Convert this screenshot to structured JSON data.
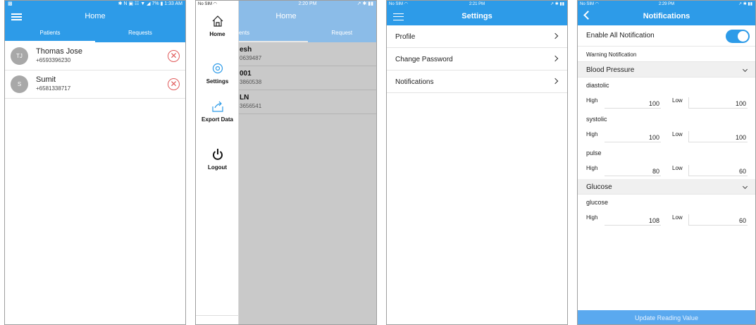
{
  "phone1": {
    "status_right": "✱ N ▣ ☷ ▼ ◢ 7% ▮ 1:33 AM",
    "title": "Home",
    "tabs": [
      "Patients",
      "Requests"
    ],
    "patients": [
      {
        "initials": "TJ",
        "name": "Thomas Jose",
        "phone": "+6593396230"
      },
      {
        "initials": "S",
        "name": "Sumit",
        "phone": "+6581338717"
      }
    ],
    "remove_glyph": "✕"
  },
  "phone2": {
    "status_left": "No SIM ◠",
    "status_time": "2:20 PM",
    "status_right": "↗ ✱ ▮▮",
    "title": "Home",
    "tabs": [
      "ents",
      "Request"
    ],
    "list": [
      {
        "name": "esh",
        "phone": "0639487"
      },
      {
        "name": "001",
        "phone": "3860538"
      },
      {
        "name": "LN",
        "phone": "3656541"
      }
    ],
    "drawer": [
      "Home",
      "Settings",
      "Export Data",
      "Logout"
    ]
  },
  "phone3": {
    "status_left": "No SIM ◠",
    "status_time": "2:21 PM",
    "status_right": "↗ ✱ ▮▮",
    "title": "Settings",
    "rows": [
      "Profile",
      "Change Password",
      "Notifications"
    ]
  },
  "phone4": {
    "status_left": "No SIM ◠",
    "status_time": "2:29 PM",
    "status_right": "↗ ✱ ▮▮",
    "title": "Notifications",
    "enable_all": "Enable All Notification",
    "warning": "Warning Notification",
    "high_label": "High",
    "low_label": "Low",
    "sections": [
      {
        "title": "Blood Pressure",
        "groups": [
          {
            "label": "diastolic",
            "high": "100",
            "low": "100"
          },
          {
            "label": "systolic",
            "high": "100",
            "low": "100"
          },
          {
            "label": "pulse",
            "high": "80",
            "low": "60"
          }
        ]
      },
      {
        "title": "Glucose",
        "groups": [
          {
            "label": "glucose",
            "high": "108",
            "low": "60"
          }
        ]
      }
    ],
    "update_button": "Update Reading Value"
  },
  "colors": {
    "primary": "#2d9be8",
    "remove": "#e05a5a",
    "button": "#5aa9ef"
  }
}
